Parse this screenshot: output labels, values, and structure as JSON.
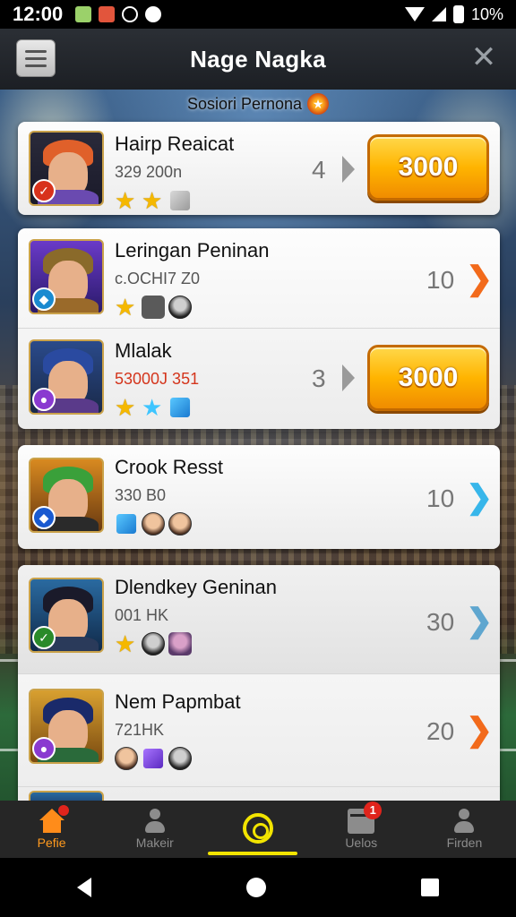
{
  "status_bar": {
    "time": "12:00",
    "battery": "10%"
  },
  "header": {
    "title": "Nage Nagka"
  },
  "session": {
    "label": "Sosiori Pernona"
  },
  "featured": {
    "name": "Hairp Reaicat",
    "sub": "329 200n",
    "rank": "4",
    "button_label": "3000"
  },
  "players": [
    {
      "name": "Leringan Peninan",
      "sub": "c.OCHI7 Z0",
      "rank": "10",
      "arrow": "orange"
    },
    {
      "name": "Mlalak",
      "sub": "53000J 351",
      "rank": "3",
      "button_label": "3000"
    },
    {
      "name": "Crook Resst",
      "sub": "330 B0",
      "rank": "10",
      "arrow": "blue"
    },
    {
      "name": "Dlendkey Geninan",
      "sub": "001 HK",
      "rank": "30",
      "arrow": "steel"
    },
    {
      "name": "Nem Papmbat",
      "sub": "721HK",
      "rank": "20",
      "arrow": "orange"
    }
  ],
  "bottom_nav": [
    {
      "label": "Pefie",
      "icon": "home-icon",
      "active": true,
      "notif": ""
    },
    {
      "label": "Makeir",
      "icon": "person-icon",
      "active": false,
      "notif": ""
    },
    {
      "label": "",
      "icon": "spiral-icon",
      "active": true,
      "notif": ""
    },
    {
      "label": "Uelos",
      "icon": "calendar-icon",
      "active": false,
      "notif": "1"
    },
    {
      "label": "Firden",
      "icon": "person-icon",
      "active": false,
      "notif": ""
    }
  ],
  "colors": {
    "accent_gold": "#ffb400",
    "arrow_orange": "#f26a1b",
    "arrow_blue": "#37b6ea",
    "nav_active": "#f2e400"
  }
}
